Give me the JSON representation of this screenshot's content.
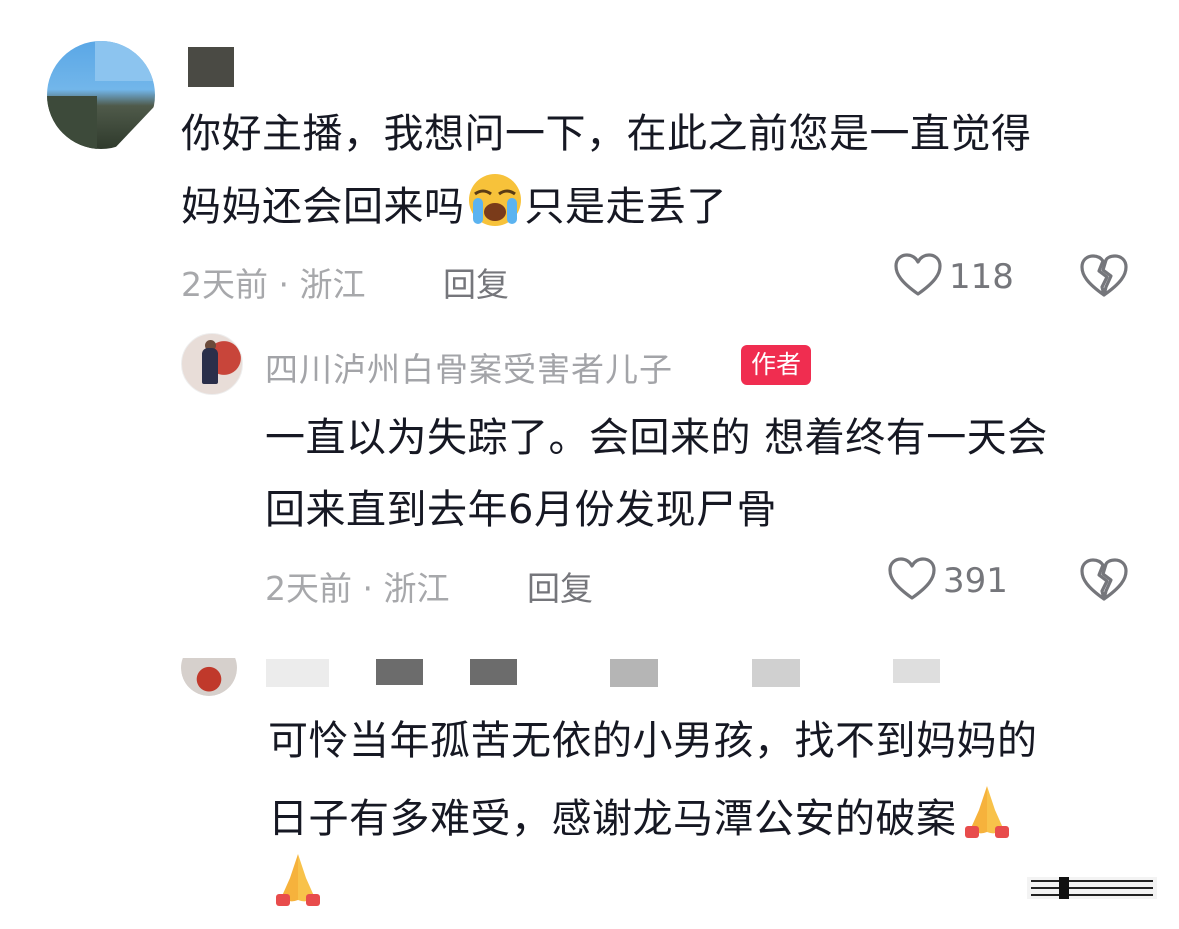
{
  "comments": [
    {
      "line1": "你好主播，我想问一下，在此之前您是一直觉得",
      "line2_before": "妈妈还会回来吗",
      "line2_emoji": "loudly-crying-face-emoji",
      "line2_after": "只是走丢了",
      "meta": "2天前 · 浙江",
      "reply": "回复",
      "likes": "118"
    },
    {
      "username": "四川泸州白骨案受害者儿子",
      "badge": "作者",
      "line1": "一直以为失踪了。会回来的 想着终有一天会",
      "line2": "回来直到去年6月份发现尸骨",
      "meta": "2天前 · 浙江",
      "reply": "回复",
      "likes": "391"
    },
    {
      "line1": "可怜当年孤苦无依的小男孩，找不到妈妈的",
      "line2": "日子有多难受，感谢龙马潭公安的破案",
      "emoji": "folded-hands-emoji"
    }
  ],
  "colors": {
    "text": "#161823",
    "meta": "#a7a8ab",
    "reply": "#75767b",
    "badge": "#f02d50"
  }
}
